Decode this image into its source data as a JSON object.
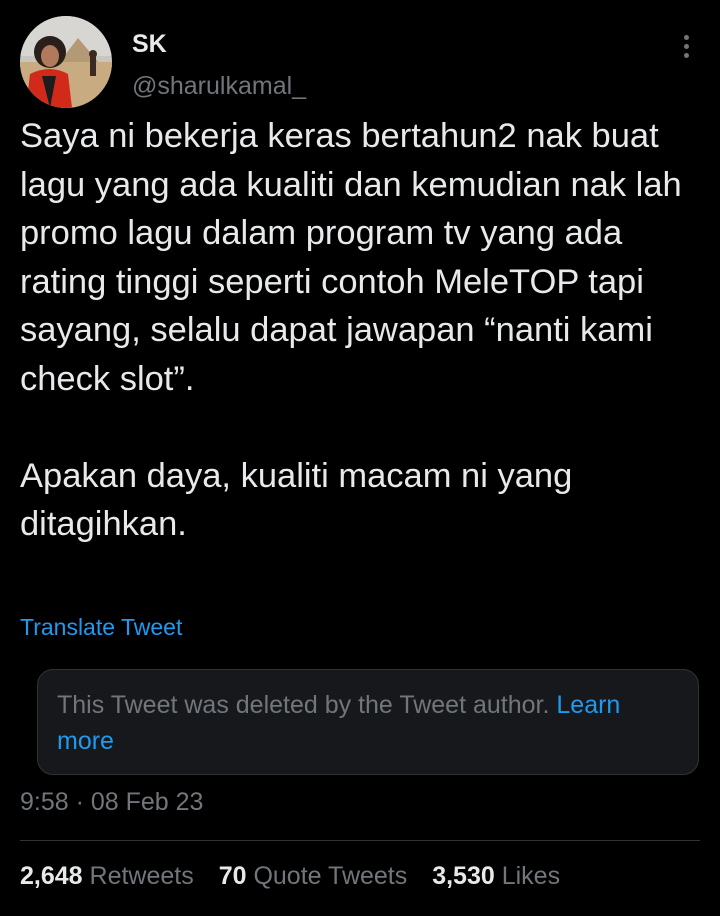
{
  "author": {
    "name": "SK",
    "handle": "@sharulkamal_"
  },
  "tweet": {
    "paragraphs": [
      "Saya ni bekerja keras bertahun2 nak buat lagu yang ada kualiti dan kemudian nak lah promo lagu dalam program tv yang ada rating tinggi seperti contoh MeleTOP tapi sayang, selalu dapat jawapan “nanti kami check slot”.",
      "Apakan daya, kualiti macam ni yang ditagihkan."
    ],
    "translate_label": "Translate Tweet"
  },
  "quoted": {
    "deleted_message": "This Tweet was deleted by the Tweet author.",
    "learn_more": "Learn more"
  },
  "timestamp": "9:58 · 08 Feb 23",
  "stats": {
    "retweets_count": "2,648",
    "retweets_label": "Retweets",
    "quotes_count": "70",
    "quotes_label": "Quote Tweets",
    "likes_count": "3,530",
    "likes_label": "Likes"
  },
  "colors": {
    "background": "#000000",
    "text": "#e7e9ea",
    "secondary": "#71767b",
    "link": "#1d9bf0",
    "card": "#16181c",
    "border": "#2f3336"
  }
}
